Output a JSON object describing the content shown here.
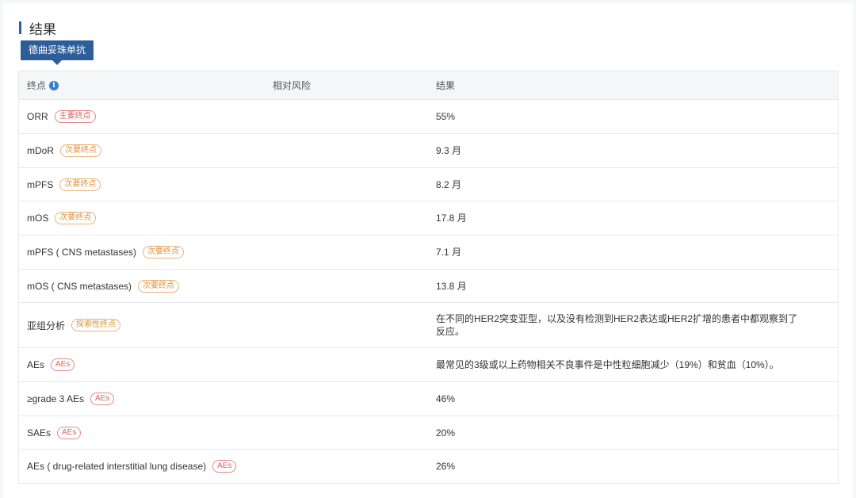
{
  "section": {
    "title": "结果"
  },
  "drug_tab": {
    "label": "德曲妥珠单抗"
  },
  "table": {
    "headers": {
      "endpoint": "终点",
      "relative_risk": "相对风险",
      "result": "结果"
    },
    "info_icon_glyph": "i",
    "rows": [
      {
        "endpoint": "ORR",
        "badge": "主要终点",
        "badge_type": "primary",
        "risk": "",
        "result": "55%"
      },
      {
        "endpoint": "mDoR",
        "badge": "次要终点",
        "badge_type": "secondary",
        "risk": "",
        "result": "9.3 月"
      },
      {
        "endpoint": "mPFS",
        "badge": "次要终点",
        "badge_type": "secondary",
        "risk": "",
        "result": "8.2 月"
      },
      {
        "endpoint": "mOS",
        "badge": "次要终点",
        "badge_type": "secondary",
        "risk": "",
        "result": "17.8 月"
      },
      {
        "endpoint": "mPFS ( CNS metastases)",
        "badge": "次要终点",
        "badge_type": "secondary",
        "risk": "",
        "result": "7.1 月"
      },
      {
        "endpoint": "mOS ( CNS metastases)",
        "badge": "次要终点",
        "badge_type": "secondary",
        "risk": "",
        "result": "13.8 月"
      },
      {
        "endpoint": "亚组分析",
        "badge": "探索性终点",
        "badge_type": "explore",
        "risk": "",
        "result": "在不同的HER2突变亚型，以及没有检测到HER2表达或HER2扩增的患者中都观察到了反应。"
      },
      {
        "endpoint": "AEs",
        "badge": "AEs",
        "badge_type": "ae",
        "risk": "",
        "result": "最常见的3级或以上药物相关不良事件是中性粒细胞减少（19%）和贫血（10%）。"
      },
      {
        "endpoint": "≥grade 3 AEs",
        "badge": "AEs",
        "badge_type": "ae",
        "risk": "",
        "result": "46%"
      },
      {
        "endpoint": "SAEs",
        "badge": "AEs",
        "badge_type": "ae",
        "risk": "",
        "result": "20%"
      },
      {
        "endpoint": "AEs ( drug-related interstitial lung disease)",
        "badge": "AEs",
        "badge_type": "ae",
        "risk": "",
        "result": "26%"
      }
    ]
  },
  "colors": {
    "accent": "#2d5fa5",
    "tab_bg": "#2d5e9a",
    "primary_badge": "#e06060",
    "secondary_badge": "#e0913a"
  }
}
